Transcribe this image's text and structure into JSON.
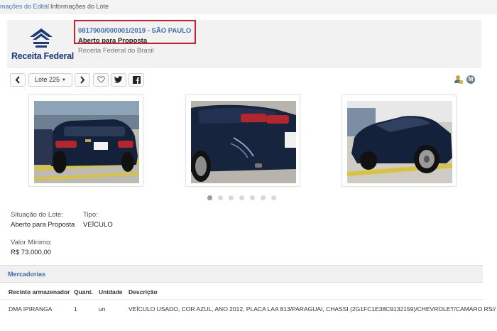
{
  "breadcrumb": {
    "link": "mações do Edital",
    "separator": "/",
    "current": "Informações do Lote"
  },
  "header": {
    "logo_text": "Receita Federal",
    "lot_number": "0817900/000001/2019 - SÃO PAULO",
    "status": "Aberto para Proposta",
    "organization": "Receita Federal do Brasil"
  },
  "toolbar": {
    "prev_icon": "chevron-left-icon",
    "lote_label": "Lote 225",
    "next_icon": "chevron-right-icon",
    "favorite_icon": "heart-icon",
    "twitter_icon": "twitter-icon",
    "facebook_icon": "facebook-icon"
  },
  "header_icons": {
    "user_icon": "user-lock-icon",
    "m_label": "M"
  },
  "photos": [
    {
      "alt": "car-rear-left-photo"
    },
    {
      "alt": "car-rear-damage-photo"
    },
    {
      "alt": "car-side-photo"
    }
  ],
  "carousel": {
    "dot_count": 7,
    "active_index": 0
  },
  "info": {
    "situacao_label": "Situação do Lote:",
    "situacao_value": "Aberto para Proposta",
    "tipo_label": "Tipo:",
    "tipo_value": "VEÍCULO",
    "valor_label": "Valor Mínimo:",
    "valor_value": "R$ 73.000,00"
  },
  "mercadorias": {
    "title": "Mercadorias",
    "columns": [
      "Recinto armazenador",
      "Quant.",
      "Unidade",
      "Descrição"
    ],
    "rows": [
      [
        "DMA IPIRANGA",
        "1",
        "un",
        "VEÍCULO USADO, COR AZUL, ANO 2012, PLACA LAA 813/PARAGUAI, CHASSI (2G1FC1E38C9132159)/CHEVROLET/CAMARO RS//"
      ]
    ]
  },
  "colors": {
    "link_blue": "#3c6da8",
    "highlight_red": "#c4222b",
    "logo_navy": "#1c3b7a"
  }
}
